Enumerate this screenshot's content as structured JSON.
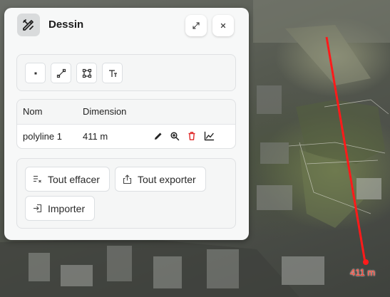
{
  "panel": {
    "title": "Dessin",
    "icon": "draw-tools-icon",
    "expand_icon": "expand-icon",
    "close_icon": "close-icon"
  },
  "tools": [
    {
      "name": "point-tool",
      "icon": "point-icon"
    },
    {
      "name": "line-tool",
      "icon": "line-icon"
    },
    {
      "name": "polygon-tool",
      "icon": "polygon-icon"
    },
    {
      "name": "text-tool",
      "icon": "text-icon"
    }
  ],
  "table": {
    "headers": [
      "Nom",
      "Dimension"
    ],
    "rows": [
      {
        "nom": "polyline 1",
        "dimension": "411 m",
        "actions": [
          "edit-icon",
          "zoom-icon",
          "delete-icon",
          "profile-chart-icon"
        ]
      }
    ]
  },
  "actions": {
    "clear_all": "Tout effacer",
    "export_all": "Tout exporter",
    "import": "Importer"
  },
  "map": {
    "measure_label": "411 m",
    "line_color": "#ff1a1a"
  }
}
